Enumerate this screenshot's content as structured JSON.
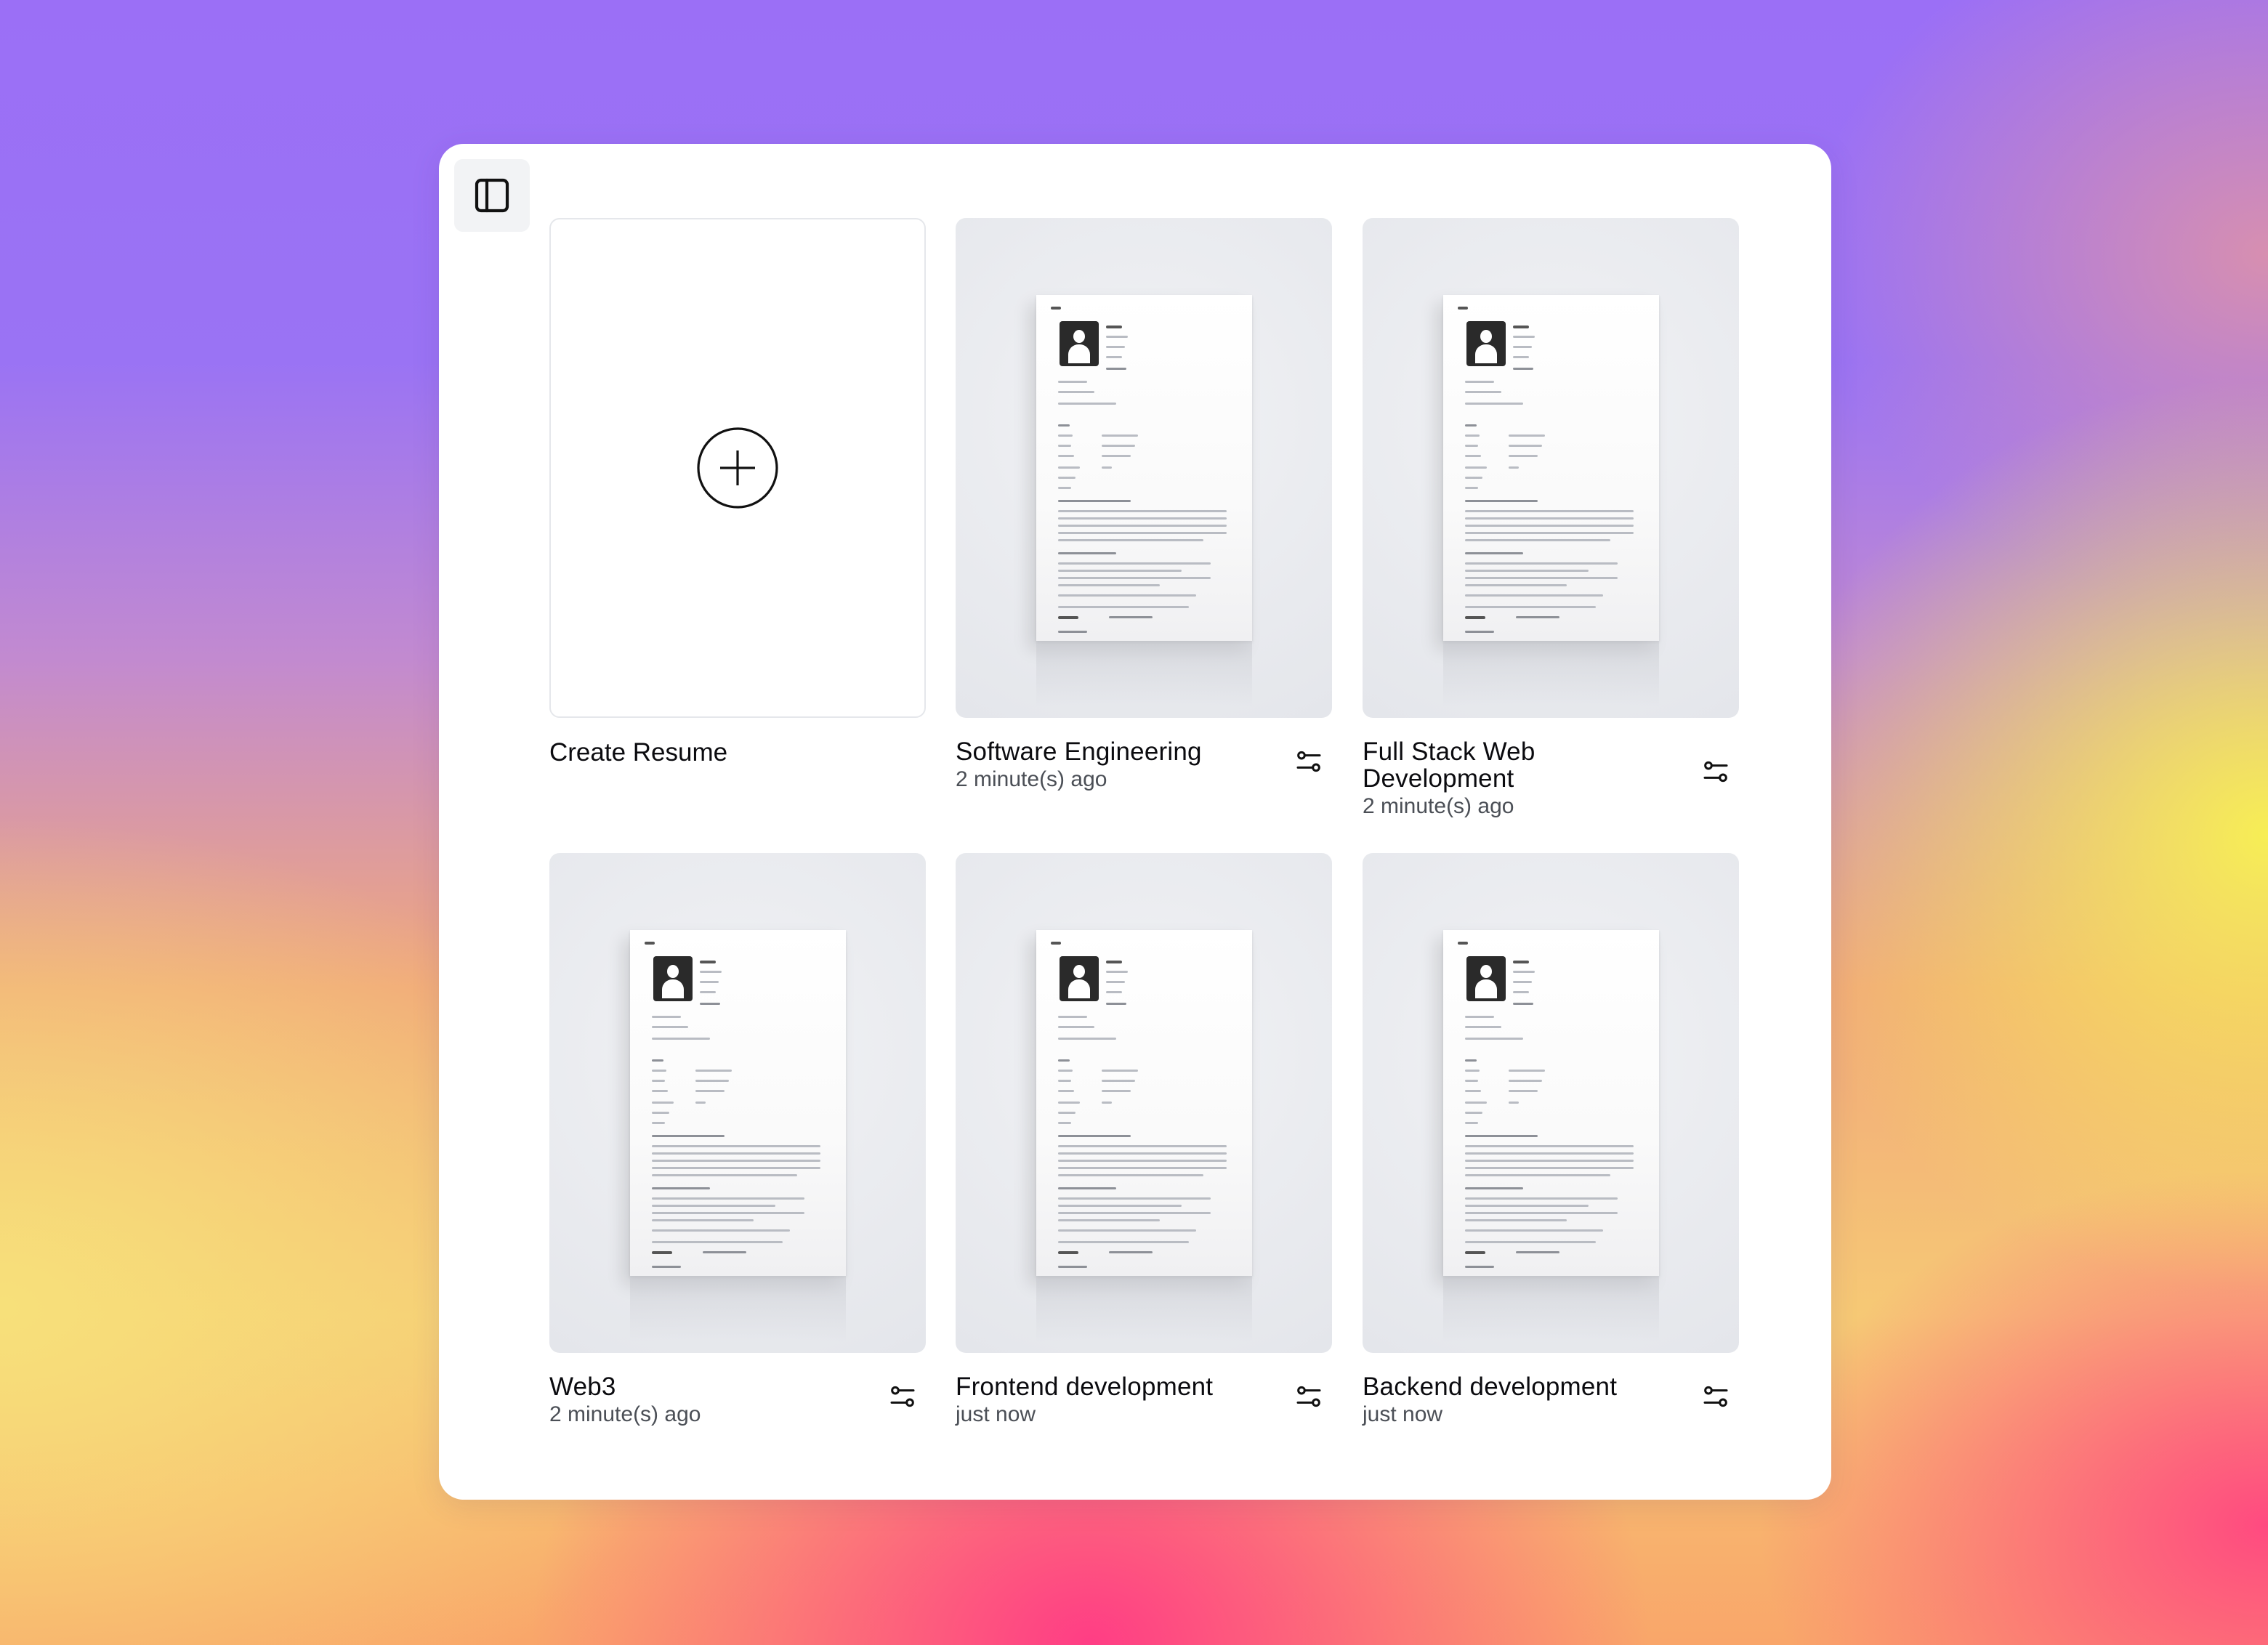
{
  "sidebar_toggle": {
    "icon": "sidebar-panel-icon"
  },
  "create_card": {
    "label": "Create Resume",
    "icon": "plus-circle-icon"
  },
  "resumes": [
    {
      "title": "Software Engineering",
      "updated": "2 minute(s) ago",
      "action_icon": "settings-sliders-icon"
    },
    {
      "title": "Full Stack Web Development",
      "updated": "2 minute(s) ago",
      "action_icon": "settings-sliders-icon"
    },
    {
      "title": "Web3",
      "updated": "2 minute(s) ago",
      "action_icon": "settings-sliders-icon"
    },
    {
      "title": "Frontend development",
      "updated": "just now",
      "action_icon": "settings-sliders-icon"
    },
    {
      "title": "Backend development",
      "updated": "just now",
      "action_icon": "settings-sliders-icon"
    }
  ],
  "colors": {
    "panel": "#ffffff",
    "text_primary": "#0b0b0f",
    "text_secondary": "#4b4f56",
    "toggle_bg": "#f2f3f5"
  }
}
